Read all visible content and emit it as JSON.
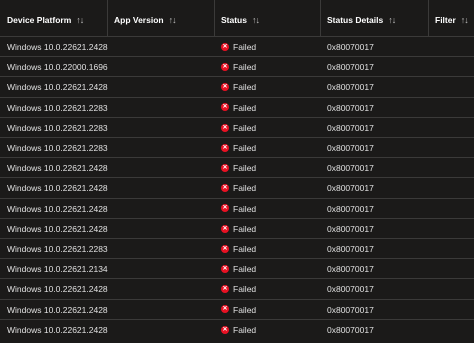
{
  "columns": [
    {
      "label": "Device Platform",
      "sort": "↑↓"
    },
    {
      "label": "App Version",
      "sort": "↑↓"
    },
    {
      "label": "Status",
      "sort": "↑↓"
    },
    {
      "label": "Status Details",
      "sort": "↑↓"
    },
    {
      "label": "Filter",
      "sort": "↑↓"
    }
  ],
  "rows": [
    {
      "platform": "Windows 10.0.22621.2428",
      "status": "Failed",
      "details": "0x80070017"
    },
    {
      "platform": "Windows 10.0.22000.1696",
      "status": "Failed",
      "details": "0x80070017"
    },
    {
      "platform": "Windows 10.0.22621.2428",
      "status": "Failed",
      "details": "0x80070017"
    },
    {
      "platform": "Windows 10.0.22621.2283",
      "status": "Failed",
      "details": "0x80070017"
    },
    {
      "platform": "Windows 10.0.22621.2283",
      "status": "Failed",
      "details": "0x80070017"
    },
    {
      "platform": "Windows 10.0.22621.2283",
      "status": "Failed",
      "details": "0x80070017"
    },
    {
      "platform": "Windows 10.0.22621.2428",
      "status": "Failed",
      "details": "0x80070017"
    },
    {
      "platform": "Windows 10.0.22621.2428",
      "status": "Failed",
      "details": "0x80070017"
    },
    {
      "platform": "Windows 10.0.22621.2428",
      "status": "Failed",
      "details": "0x80070017"
    },
    {
      "platform": "Windows 10.0.22621.2428",
      "status": "Failed",
      "details": "0x80070017"
    },
    {
      "platform": "Windows 10.0.22621.2283",
      "status": "Failed",
      "details": "0x80070017"
    },
    {
      "platform": "Windows 10.0.22621.2134",
      "status": "Failed",
      "details": "0x80070017"
    },
    {
      "platform": "Windows 10.0.22621.2428",
      "status": "Failed",
      "details": "0x80070017"
    },
    {
      "platform": "Windows 10.0.22621.2428",
      "status": "Failed",
      "details": "0x80070017"
    },
    {
      "platform": "Windows 10.0.22621.2428",
      "status": "Failed",
      "details": "0x80070017"
    }
  ],
  "status_icon": "error-circle-icon",
  "colors": {
    "failed": "#e81123",
    "background": "#1b1a19"
  }
}
